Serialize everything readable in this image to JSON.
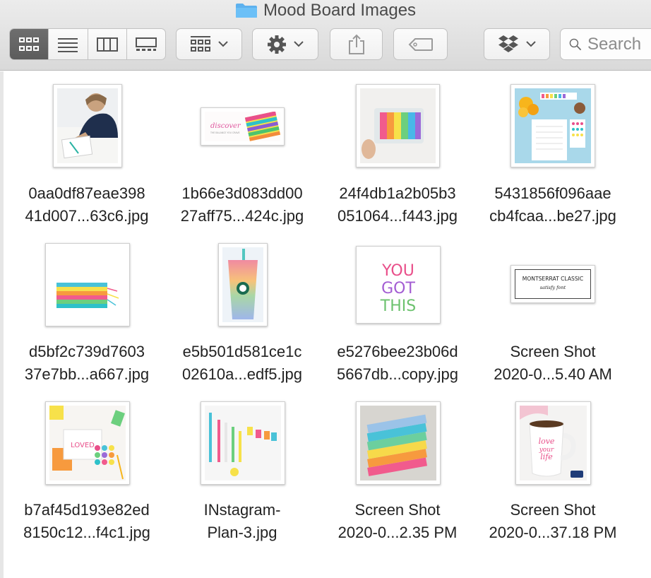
{
  "window": {
    "title": "Mood Board Images",
    "folder_icon": "folder-icon"
  },
  "toolbar": {
    "view_buttons": [
      {
        "name": "icon-view",
        "icon": "grid-icon",
        "active": true
      },
      {
        "name": "list-view",
        "icon": "list-icon",
        "active": false
      },
      {
        "name": "column-view",
        "icon": "columns-icon",
        "active": false
      },
      {
        "name": "gallery-view",
        "icon": "gallery-icon",
        "active": false
      }
    ],
    "group_icon": "group-grid-icon",
    "action_icon": "gear-icon",
    "share_icon": "share-icon",
    "tag_icon": "tag-icon",
    "dropbox_icon": "dropbox-icon",
    "search_placeholder": "Search"
  },
  "files": [
    {
      "line1": "0aa0df87eae398",
      "line2": "41d007...63c6.jpg",
      "thumb": "woman-planner"
    },
    {
      "line1": "1b66e3d083dd00",
      "line2": "27aff75...424c.jpg",
      "thumb": "discover-banner"
    },
    {
      "line1": "24f4db1a2b05b3",
      "line2": "051064...f443.jpg",
      "thumb": "washi-dispenser"
    },
    {
      "line1": "5431856f096aae",
      "line2": "cb4fcaa...be27.jpg",
      "thumb": "flatlay-blue"
    },
    {
      "line1": "d5bf2c739d7603",
      "line2": "37e7bb...a667.jpg",
      "thumb": "rainbow-notebooks"
    },
    {
      "line1": "e5b501d581ce1c",
      "line2": "02610a...edf5.jpg",
      "thumb": "starbucks-cup"
    },
    {
      "line1": "e5276bee23b06d",
      "line2": "5667db...copy.jpg",
      "thumb": "you-got-this"
    },
    {
      "line1": "Screen Shot",
      "line2": "2020-0...5.40 AM",
      "thumb": "font-card"
    },
    {
      "line1": "b7af45d193e82ed",
      "line2": "8150c12...f4c1.jpg",
      "thumb": "loved-stickers"
    },
    {
      "line1": "INstagram-",
      "line2": "Plan-3.jpg",
      "thumb": "pens-flags"
    },
    {
      "line1": "Screen Shot",
      "line2": "2020-0...2.35 PM",
      "thumb": "stacked-notebooks"
    },
    {
      "line1": "Screen Shot",
      "line2": "2020-0...37.18 PM",
      "thumb": "love-your-life-mug"
    }
  ],
  "thumb_texts": {
    "discover": "discover",
    "discover_sub": "THE BALANCE YOU CRAVE",
    "you": "YOU",
    "got": "GOT",
    "this": "THIS",
    "font_line1": "MONTSERRAT CLASSIC",
    "font_line2": "satisfy font",
    "loved": "LOVED",
    "mug_line1": "love",
    "mug_line2": "your",
    "mug_line3": "life"
  }
}
